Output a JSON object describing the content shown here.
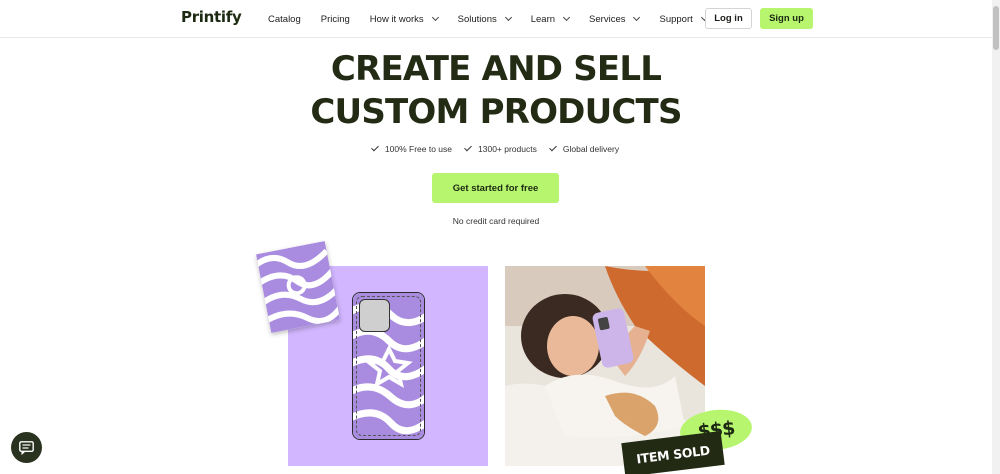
{
  "header": {
    "logo": "Printify",
    "nav": [
      {
        "label": "Catalog",
        "dropdown": false
      },
      {
        "label": "Pricing",
        "dropdown": false
      },
      {
        "label": "How it works",
        "dropdown": true
      },
      {
        "label": "Solutions",
        "dropdown": true
      },
      {
        "label": "Learn",
        "dropdown": true
      },
      {
        "label": "Services",
        "dropdown": true
      },
      {
        "label": "Support",
        "dropdown": true
      }
    ],
    "login_label": "Log in",
    "signup_label": "Sign up"
  },
  "hero": {
    "title_line1": "CREATE AND SELL",
    "title_line2": "CUSTOM PRODUCTS",
    "features": [
      "100% Free to use",
      "1300+ products",
      "Global delivery"
    ],
    "cta_label": "Get started for free",
    "cta_note": "No credit card required"
  },
  "showcase": {
    "money_badge": "$$$",
    "sold_badge": "ITEM SOLD"
  },
  "colors": {
    "accent": "#b8f56f",
    "dark": "#232b14",
    "purple": "#d2b6ff"
  },
  "icons": {
    "chat": "chat-bubble-icon",
    "check": "check-icon",
    "dropdown": "chevron-down-icon"
  }
}
